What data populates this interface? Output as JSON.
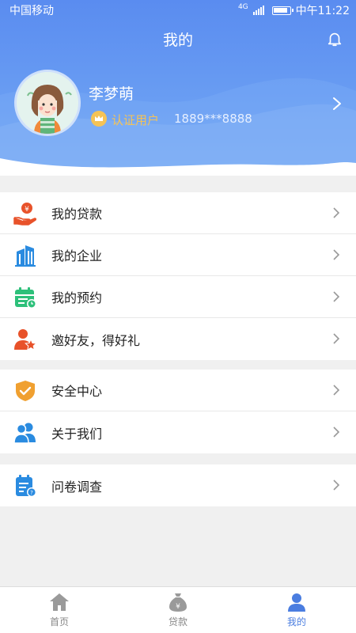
{
  "status_bar": {
    "carrier": "中国移动",
    "network": "4G",
    "time": "中午11:22"
  },
  "header": {
    "title": "我的",
    "bell_icon": "bell-icon"
  },
  "profile": {
    "name": "李梦萌",
    "verified_label": "认证用户",
    "phone": "1889***8888"
  },
  "menu_groups": [
    [
      {
        "label": "我的贷款",
        "icon": "loan-hand-icon"
      },
      {
        "label": "我的企业",
        "icon": "building-icon"
      },
      {
        "label": "我的预约",
        "icon": "calendar-icon"
      },
      {
        "label": "邀好友，得好礼",
        "icon": "invite-friend-icon"
      }
    ],
    [
      {
        "label": "安全中心",
        "icon": "shield-check-icon"
      },
      {
        "label": "关于我们",
        "icon": "users-icon"
      }
    ],
    [
      {
        "label": "问卷调查",
        "icon": "survey-icon"
      }
    ]
  ],
  "tabbar": [
    {
      "label": "首页",
      "icon": "home-icon",
      "active": false
    },
    {
      "label": "贷款",
      "icon": "money-bag-icon",
      "active": false
    },
    {
      "label": "我的",
      "icon": "person-icon",
      "active": true
    }
  ],
  "colors": {
    "header_blue": "#5a8cf0",
    "active_tab": "#4a7de0",
    "verified_gold": "#f5c356",
    "loan_orange": "#e8522a",
    "building_blue": "#2a8be0",
    "calendar_green": "#2dc07a",
    "shield_orange": "#f0a030"
  }
}
